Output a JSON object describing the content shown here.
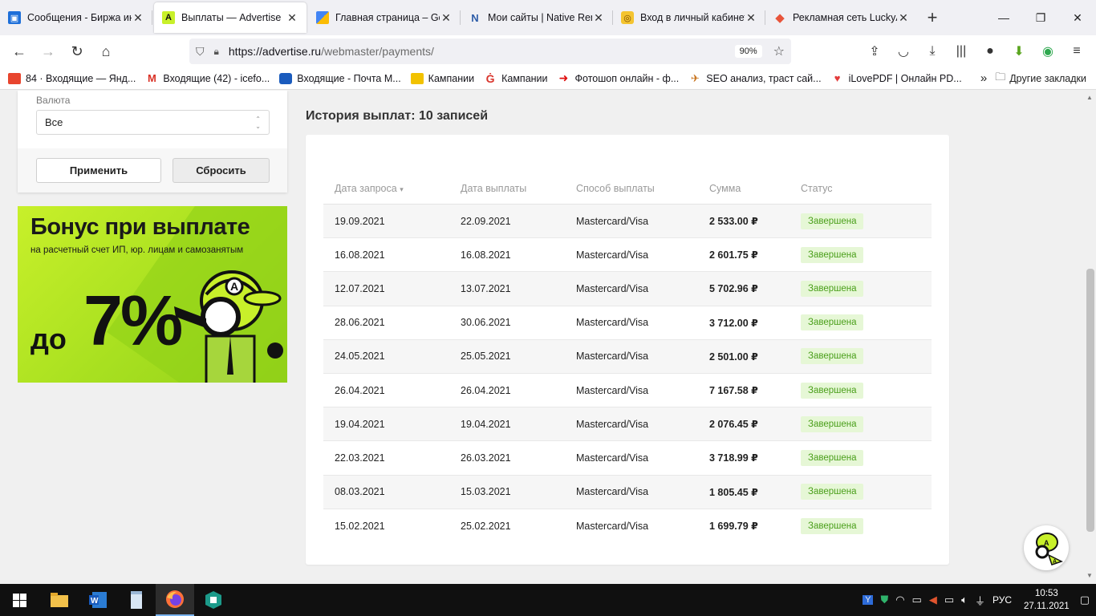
{
  "browser": {
    "tabs": [
      {
        "title": "Сообщения - Биржа инт",
        "icon": "screen-icon",
        "color": "#1e6fd9"
      },
      {
        "title": "Выплаты — Advertise",
        "icon": "advertise-logo-icon",
        "color": "#c8f02a",
        "active": true
      },
      {
        "title": "Главная страница – Goo",
        "icon": "google-ads-icon",
        "color": "#fbbc04"
      },
      {
        "title": "Мои сайты | Native Rent",
        "icon": "native-rent-icon",
        "color": "#2d5ca8"
      },
      {
        "title": "Вход в личный кабинет |",
        "icon": "coin-icon",
        "color": "#e8a21a"
      },
      {
        "title": "Рекламная сеть LuckyAd",
        "icon": "luckyad-icon",
        "color": "#e8543a"
      }
    ],
    "url_domain": "https://advertise.ru",
    "url_path": "/webmaster/payments/",
    "zoom": "90%",
    "bookmarks": [
      {
        "label": "84 · Входящие — Янд...",
        "icon": "yandex-mail-icon"
      },
      {
        "label": "Входящие (42) - icefo...",
        "icon": "gmail-icon"
      },
      {
        "label": "Входящие - Почта М...",
        "icon": "mailru-icon"
      },
      {
        "label": "Кампании",
        "icon": "campaign-icon"
      },
      {
        "label": "Кампании",
        "icon": "campaign-swirl-icon"
      },
      {
        "label": "Фотошоп онлайн - ф...",
        "icon": "arrow-red-icon"
      },
      {
        "label": "SEO анализ, траст сай...",
        "icon": "seo-bird-icon"
      },
      {
        "label": "iLovePDF | Онлайн PD...",
        "icon": "ilovepdf-icon"
      }
    ],
    "other_bookmarks": "Другие закладки"
  },
  "filters": {
    "currency_label": "Валюта",
    "currency_value": "Все",
    "apply_label": "Применить",
    "reset_label": "Сбросить"
  },
  "banner": {
    "title": "Бонус при выплате",
    "subtitle": "на расчетный счет ИП, юр. лицам и самозанятым",
    "prefix": "до",
    "percent": "7%"
  },
  "history": {
    "title": "История выплат: 10 записей",
    "columns": [
      "Дата запроса",
      "Дата выплаты",
      "Способ выплаты",
      "Сумма",
      "Статус"
    ],
    "rows": [
      {
        "request_date": "19.09.2021",
        "payout_date": "22.09.2021",
        "method": "Mastercard/Visa",
        "amount": "2 533.00 ₽",
        "status": "Завершена"
      },
      {
        "request_date": "16.08.2021",
        "payout_date": "16.08.2021",
        "method": "Mastercard/Visa",
        "amount": "2 601.75 ₽",
        "status": "Завершена"
      },
      {
        "request_date": "12.07.2021",
        "payout_date": "13.07.2021",
        "method": "Mastercard/Visa",
        "amount": "5 702.96 ₽",
        "status": "Завершена"
      },
      {
        "request_date": "28.06.2021",
        "payout_date": "30.06.2021",
        "method": "Mastercard/Visa",
        "amount": "3 712.00 ₽",
        "status": "Завершена"
      },
      {
        "request_date": "24.05.2021",
        "payout_date": "25.05.2021",
        "method": "Mastercard/Visa",
        "amount": "2 501.00 ₽",
        "status": "Завершена"
      },
      {
        "request_date": "26.04.2021",
        "payout_date": "26.04.2021",
        "method": "Mastercard/Visa",
        "amount": "7 167.58 ₽",
        "status": "Завершена"
      },
      {
        "request_date": "19.04.2021",
        "payout_date": "19.04.2021",
        "method": "Mastercard/Visa",
        "amount": "2 076.45 ₽",
        "status": "Завершена"
      },
      {
        "request_date": "22.03.2021",
        "payout_date": "26.03.2021",
        "method": "Mastercard/Visa",
        "amount": "3 718.99 ₽",
        "status": "Завершена"
      },
      {
        "request_date": "08.03.2021",
        "payout_date": "15.03.2021",
        "method": "Mastercard/Visa",
        "amount": "1 805.45 ₽",
        "status": "Завершена"
      },
      {
        "request_date": "15.02.2021",
        "payout_date": "25.02.2021",
        "method": "Mastercard/Visa",
        "amount": "1 699.79 ₽",
        "status": "Завершена"
      }
    ]
  },
  "taskbar": {
    "language": "РУС",
    "time": "10:53",
    "date": "27.11.2021"
  },
  "colors": {
    "accent_green": "#c8f02a",
    "status_text": "#4a9f1a",
    "status_bg": "#e6f7d6"
  }
}
